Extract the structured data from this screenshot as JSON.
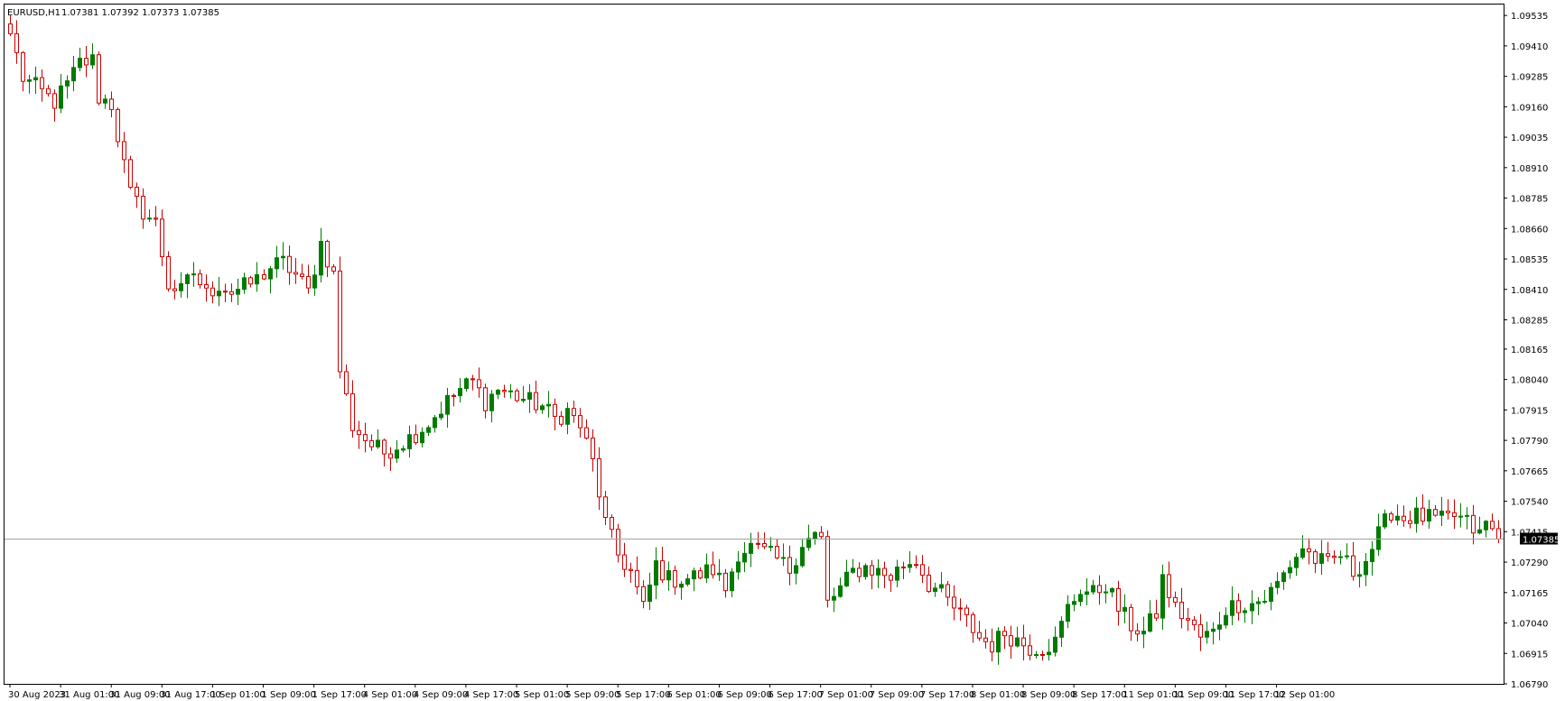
{
  "header": {
    "symbol": "EURUSD,H1",
    "ohlc": "1.07381 1.07392 1.07373 1.07385"
  },
  "current_price_label": "1.07385",
  "colors": {
    "background": "#ffffff",
    "bull": "#007b00",
    "bear": "#cc0000",
    "grid_line": "#a0a0a0",
    "text": "#000000",
    "price_tag_bg": "#000000"
  },
  "chart_data": {
    "type": "candlestick",
    "interval": "H1",
    "ylim": [
      1.0679,
      1.0958
    ],
    "current_price": 1.07385,
    "y_ticks": [
      "1.09535",
      "1.09410",
      "1.09285",
      "1.09160",
      "1.09035",
      "1.08910",
      "1.08785",
      "1.08660",
      "1.08535",
      "1.08410",
      "1.08285",
      "1.08165",
      "1.08040",
      "1.07915",
      "1.07790",
      "1.07665",
      "1.07540",
      "1.07415",
      "1.07290",
      "1.07165",
      "1.07040",
      "1.06915",
      "1.06790"
    ],
    "x_ticks": [
      "30 Aug 2023",
      "31 Aug 01:00",
      "31 Aug 09:00",
      "31 Aug 17:00",
      "1 Sep 01:00",
      "1 Sep 09:00",
      "1 Sep 17:00",
      "4 Sep 01:00",
      "4 Sep 09:00",
      "4 Sep 17:00",
      "5 Sep 01:00",
      "5 Sep 09:00",
      "5 Sep 17:00",
      "6 Sep 01:00",
      "6 Sep 09:00",
      "6 Sep 17:00",
      "7 Sep 01:00",
      "7 Sep 09:00",
      "7 Sep 17:00",
      "8 Sep 01:00",
      "8 Sep 09:00",
      "8 Sep 17:00",
      "11 Sep 01:00",
      "11 Sep 09:00",
      "11 Sep 17:00",
      "12 Sep 01:00"
    ],
    "anchors": [
      [
        0,
        1.0946
      ],
      [
        2,
        1.0928
      ],
      [
        5,
        1.0922
      ],
      [
        7,
        1.0918
      ],
      [
        9,
        1.0925
      ],
      [
        11,
        1.0934
      ],
      [
        13,
        1.0935
      ],
      [
        14,
        1.092
      ],
      [
        16,
        1.0917
      ],
      [
        17,
        1.0904
      ],
      [
        19,
        1.088
      ],
      [
        21,
        1.0873
      ],
      [
        23,
        1.0868
      ],
      [
        25,
        1.0843
      ],
      [
        27,
        1.084
      ],
      [
        29,
        1.0848
      ],
      [
        31,
        1.0839
      ],
      [
        33,
        1.0843
      ],
      [
        35,
        1.084
      ],
      [
        37,
        1.0842
      ],
      [
        39,
        1.0845
      ],
      [
        41,
        1.085
      ],
      [
        43,
        1.0852
      ],
      [
        45,
        1.0847
      ],
      [
        47,
        1.084
      ],
      [
        49,
        1.086
      ],
      [
        51,
        1.0847
      ],
      [
        52,
        1.0808
      ],
      [
        54,
        1.0785
      ],
      [
        57,
        1.0777
      ],
      [
        59,
        1.0774
      ],
      [
        63,
        1.078
      ],
      [
        66,
        1.0786
      ],
      [
        69,
        1.0795
      ],
      [
        71,
        1.08
      ],
      [
        73,
        1.0803
      ],
      [
        75,
        1.0795
      ],
      [
        77,
        1.08
      ],
      [
        81,
        1.0796
      ],
      [
        84,
        1.0793
      ],
      [
        86,
        1.0788
      ],
      [
        88,
        1.0791
      ],
      [
        90,
        1.0785
      ],
      [
        92,
        1.077
      ],
      [
        94,
        1.0745
      ],
      [
        96,
        1.0732
      ],
      [
        98,
        1.0725
      ],
      [
        100,
        1.071
      ],
      [
        102,
        1.0728
      ],
      [
        104,
        1.0722
      ],
      [
        106,
        1.0722
      ],
      [
        108,
        1.0723
      ],
      [
        111,
        1.0726
      ],
      [
        113,
        1.0718
      ],
      [
        115,
        1.0733
      ],
      [
        117,
        1.0735
      ],
      [
        119,
        1.0733
      ],
      [
        121,
        1.073
      ],
      [
        123,
        1.0726
      ],
      [
        125,
        1.0737
      ],
      [
        127,
        1.074
      ],
      [
        128,
        1.0738
      ],
      [
        129,
        1.0712
      ],
      [
        131,
        1.0718
      ],
      [
        133,
        1.0725
      ],
      [
        135,
        1.0727
      ],
      [
        137,
        1.0725
      ],
      [
        139,
        1.0723
      ],
      [
        141,
        1.0728
      ],
      [
        143,
        1.073
      ],
      [
        145,
        1.072
      ],
      [
        147,
        1.0716
      ],
      [
        149,
        1.071
      ],
      [
        151,
        1.0705
      ],
      [
        153,
        1.0698
      ],
      [
        155,
        1.0695
      ],
      [
        157,
        1.07
      ],
      [
        159,
        1.0697
      ],
      [
        161,
        1.0694
      ],
      [
        163,
        1.0694
      ],
      [
        165,
        1.0696
      ],
      [
        167,
        1.071
      ],
      [
        169,
        1.0718
      ],
      [
        171,
        1.0716
      ],
      [
        173,
        1.072
      ],
      [
        175,
        1.071
      ],
      [
        177,
        1.0703
      ],
      [
        179,
        1.07
      ],
      [
        181,
        1.0708
      ],
      [
        182,
        1.0722
      ],
      [
        184,
        1.071
      ],
      [
        186,
        1.0705
      ],
      [
        188,
        1.0698
      ],
      [
        190,
        1.07
      ],
      [
        192,
        1.071
      ],
      [
        194,
        1.0712
      ],
      [
        196,
        1.0712
      ],
      [
        198,
        1.0714
      ],
      [
        200,
        1.072
      ],
      [
        202,
        1.0728
      ],
      [
        204,
        1.0735
      ],
      [
        206,
        1.073
      ],
      [
        208,
        1.0728
      ],
      [
        210,
        1.0732
      ],
      [
        212,
        1.0725
      ],
      [
        214,
        1.073
      ],
      [
        216,
        1.074
      ],
      [
        218,
        1.075
      ],
      [
        220,
        1.0747
      ],
      [
        222,
        1.0748
      ],
      [
        224,
        1.0747
      ],
      [
        226,
        1.0746
      ],
      [
        228,
        1.0748
      ],
      [
        230,
        1.0745
      ],
      [
        232,
        1.074
      ],
      [
        233,
        1.0745
      ],
      [
        235,
        1.07385
      ]
    ]
  }
}
